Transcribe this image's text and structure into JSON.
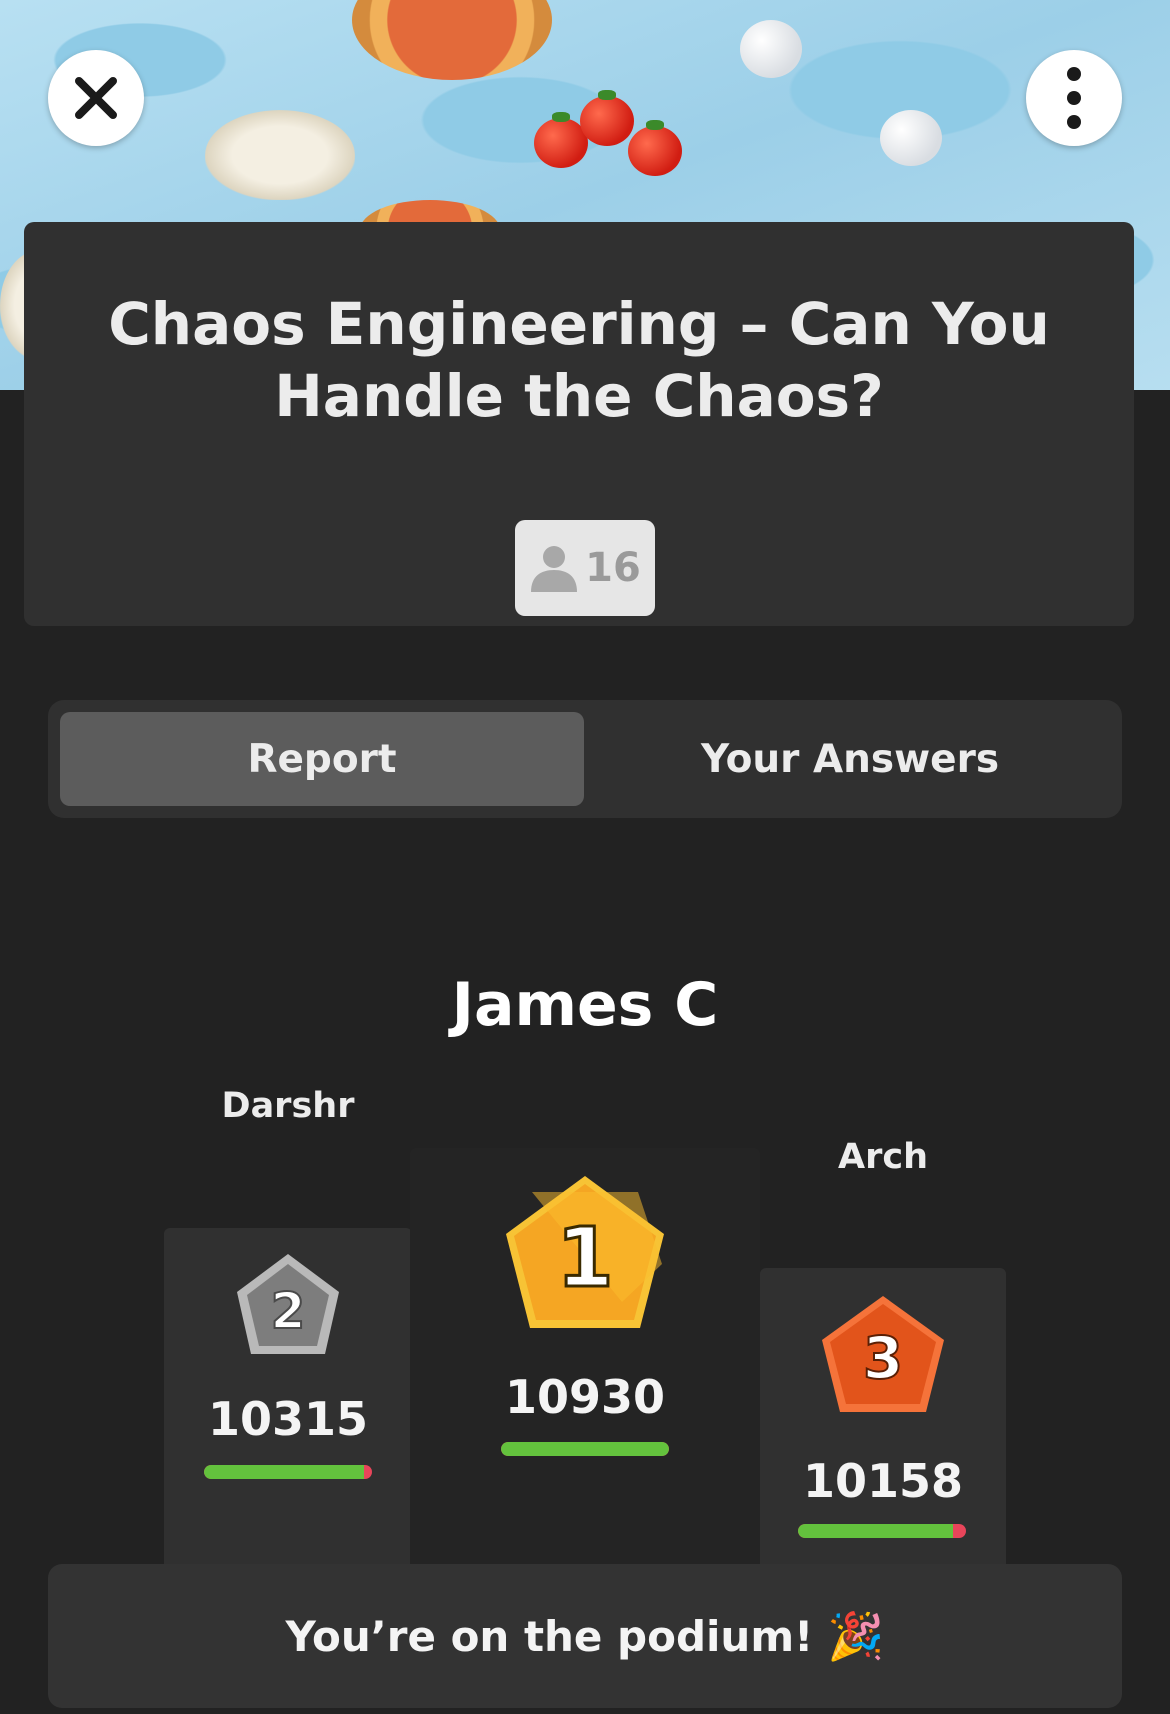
{
  "quiz": {
    "title": "Chaos Engineering – Can You Handle the Chaos?",
    "players_count": "16"
  },
  "tabs": [
    {
      "label": "Report",
      "active": true
    },
    {
      "label": "Your Answers",
      "active": false
    }
  ],
  "podium": {
    "first": {
      "name": "James C",
      "rank": "1",
      "score": "10930",
      "accuracy": 1.0
    },
    "second": {
      "name": "Darshr",
      "rank": "2",
      "score": "10315",
      "accuracy": 0.95
    },
    "third": {
      "name": "Arch",
      "rank": "3",
      "score": "10158",
      "accuracy": 0.92
    }
  },
  "banner": {
    "text": "You’re on the podium!",
    "emoji": "🎉"
  },
  "icons": {
    "close": "close-icon",
    "more": "more-vertical-icon",
    "players": "person-icon",
    "celebration": "party-popper-icon"
  },
  "colors": {
    "background": "#222222",
    "card": "#303030",
    "gold": "#f5a623",
    "silver": "#8c8c8c",
    "bronze": "#e2541b",
    "correct": "#63c23d",
    "incorrect": "#e8455a"
  }
}
